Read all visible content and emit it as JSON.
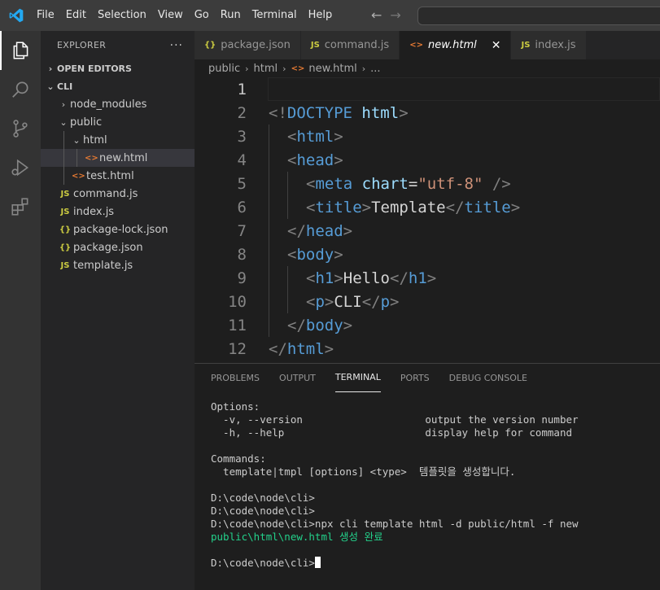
{
  "menu": [
    "File",
    "Edit",
    "Selection",
    "View",
    "Go",
    "Run",
    "Terminal",
    "Help"
  ],
  "nav": {
    "back": "←",
    "forward": "→"
  },
  "sidebar": {
    "title": "EXPLORER",
    "more": "···",
    "open_editors": "OPEN EDITORS",
    "root": "CLI",
    "items": [
      {
        "label": "node_modules",
        "type": "folder",
        "chevron": "›",
        "level": 1
      },
      {
        "label": "public",
        "type": "folder-open",
        "chevron": "⌄",
        "level": 1
      },
      {
        "label": "html",
        "type": "folder-open",
        "chevron": "⌄",
        "level": 2
      },
      {
        "label": "new.html",
        "type": "html",
        "icon": "<>",
        "level": 3,
        "selected": true
      },
      {
        "label": "test.html",
        "type": "html",
        "icon": "<>",
        "level": 2
      },
      {
        "label": "command.js",
        "type": "js",
        "icon": "JS",
        "level": 1
      },
      {
        "label": "index.js",
        "type": "js",
        "icon": "JS",
        "level": 1
      },
      {
        "label": "package-lock.json",
        "type": "json",
        "icon": "{}",
        "level": 1
      },
      {
        "label": "package.json",
        "type": "json",
        "icon": "{}",
        "level": 1
      },
      {
        "label": "template.js",
        "type": "js",
        "icon": "JS",
        "level": 1
      }
    ]
  },
  "tabs": [
    {
      "label": "package.json",
      "icon": "{}",
      "type": "json"
    },
    {
      "label": "command.js",
      "icon": "JS",
      "type": "js"
    },
    {
      "label": "new.html",
      "icon": "<>",
      "type": "html",
      "active": true,
      "close": "✕"
    },
    {
      "label": "index.js",
      "icon": "JS",
      "type": "js"
    }
  ],
  "breadcrumb": {
    "p1": "public",
    "p2": "html",
    "p3": "new.html",
    "p4": "...",
    "sep": "›",
    "icon": "<>"
  },
  "editor": {
    "line_numbers": [
      "1",
      "2",
      "3",
      "4",
      "5",
      "6",
      "7",
      "8",
      "9",
      "10",
      "11",
      "12"
    ],
    "current_line": 1,
    "lines": [
      [],
      [
        [
          "t-punct",
          "<!"
        ],
        [
          "t-tag",
          "DOCTYPE"
        ],
        [
          "t-text",
          " "
        ],
        [
          "t-attr",
          "html"
        ],
        [
          "t-punct",
          ">"
        ]
      ],
      [
        [
          "t-punct",
          "<"
        ],
        [
          "t-tag",
          "html"
        ],
        [
          "t-punct",
          ">"
        ]
      ],
      [
        [
          "t-punct",
          "<"
        ],
        [
          "t-tag",
          "head"
        ],
        [
          "t-punct",
          ">"
        ]
      ],
      [
        [
          "t-punct",
          "<"
        ],
        [
          "t-tag",
          "meta"
        ],
        [
          "t-text",
          " "
        ],
        [
          "t-attr",
          "chart"
        ],
        [
          "t-text",
          "="
        ],
        [
          "t-str",
          "\"utf-8\""
        ],
        [
          "t-text",
          " "
        ],
        [
          "t-punct",
          "/>"
        ]
      ],
      [
        [
          "t-punct",
          "<"
        ],
        [
          "t-tag",
          "title"
        ],
        [
          "t-punct",
          ">"
        ],
        [
          "t-text",
          "Template"
        ],
        [
          "t-punct",
          "</"
        ],
        [
          "t-tag",
          "title"
        ],
        [
          "t-punct",
          ">"
        ]
      ],
      [
        [
          "t-punct",
          "</"
        ],
        [
          "t-tag",
          "head"
        ],
        [
          "t-punct",
          ">"
        ]
      ],
      [
        [
          "t-punct",
          "<"
        ],
        [
          "t-tag",
          "body"
        ],
        [
          "t-punct",
          ">"
        ]
      ],
      [
        [
          "t-punct",
          "<"
        ],
        [
          "t-tag",
          "h1"
        ],
        [
          "t-punct",
          ">"
        ],
        [
          "t-text",
          "Hello"
        ],
        [
          "t-punct",
          "</"
        ],
        [
          "t-tag",
          "h1"
        ],
        [
          "t-punct",
          ">"
        ]
      ],
      [
        [
          "t-punct",
          "<"
        ],
        [
          "t-tag",
          "p"
        ],
        [
          "t-punct",
          ">"
        ],
        [
          "t-text",
          "CLI"
        ],
        [
          "t-punct",
          "</"
        ],
        [
          "t-tag",
          "p"
        ],
        [
          "t-punct",
          ">"
        ]
      ],
      [
        [
          "t-punct",
          "</"
        ],
        [
          "t-tag",
          "body"
        ],
        [
          "t-punct",
          ">"
        ]
      ],
      [
        [
          "t-punct",
          "</"
        ],
        [
          "t-tag",
          "html"
        ],
        [
          "t-punct",
          ">"
        ]
      ]
    ],
    "indents": [
      0,
      0,
      1,
      1,
      2,
      2,
      1,
      1,
      2,
      2,
      1,
      0
    ]
  },
  "panel": {
    "tabs": [
      "PROBLEMS",
      "OUTPUT",
      "TERMINAL",
      "PORTS",
      "DEBUG CONSOLE"
    ],
    "active_tab": "TERMINAL"
  },
  "terminal": {
    "lines": [
      {
        "text": "Options:"
      },
      {
        "text": "  -v, --version                    output the version number"
      },
      {
        "text": "  -h, --help                       display help for command"
      },
      {
        "text": ""
      },
      {
        "text": "Commands:"
      },
      {
        "text": "  template|tmpl [options] <type>  템플릿을 생성합니다."
      },
      {
        "text": ""
      },
      {
        "text": "D:\\code\\node\\cli>"
      },
      {
        "text": "D:\\code\\node\\cli>"
      },
      {
        "text": "D:\\code\\node\\cli>npx cli template html -d public/html -f new"
      },
      {
        "text": "public\\html\\new.html 생성 완료",
        "color": "green"
      },
      {
        "text": ""
      },
      {
        "text": "D:\\code\\node\\cli>",
        "cursor": true
      }
    ]
  },
  "colors": {
    "accent_logo": "#23a9f2",
    "green_output": "#23d18b",
    "tag": "#569cd6",
    "attr": "#9cdcfe",
    "string": "#ce9178"
  }
}
